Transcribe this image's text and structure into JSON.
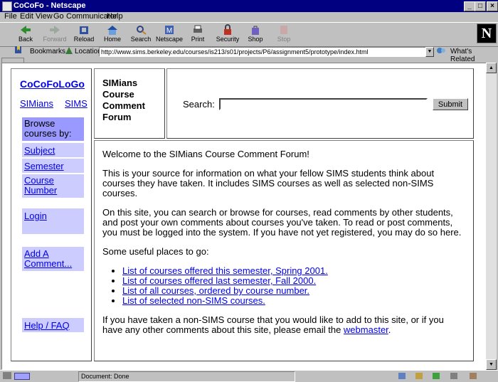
{
  "window": {
    "title": "CoCoFo - Netscape"
  },
  "menu": [
    "File",
    "Edit",
    "View",
    "Go",
    "Communicator",
    "Help"
  ],
  "toolbar": {
    "buttons": [
      {
        "label": "Back",
        "icon": "back-arrow-icon",
        "disabled": false
      },
      {
        "label": "Forward",
        "icon": "forward-arrow-icon",
        "disabled": true
      },
      {
        "label": "Reload",
        "icon": "reload-icon",
        "disabled": false
      },
      {
        "label": "Home",
        "icon": "home-icon",
        "disabled": false
      },
      {
        "label": "Search",
        "icon": "search-icon",
        "disabled": false
      },
      {
        "label": "Netscape",
        "icon": "netscape-icon",
        "disabled": false
      },
      {
        "label": "Print",
        "icon": "print-icon",
        "disabled": false
      },
      {
        "label": "Security",
        "icon": "lock-icon",
        "disabled": false
      },
      {
        "label": "Shop",
        "icon": "shop-icon",
        "disabled": false
      },
      {
        "label": "Stop",
        "icon": "stop-icon",
        "disabled": true
      }
    ],
    "logo": "N"
  },
  "location": {
    "bookmarks_label": "Bookmarks",
    "location_label": "Location:",
    "url": "http://www.sims.berkeley.edu/courses/is213/s01/projects/P6/assignment5/prototype/index.html",
    "whats_related": "What's Related"
  },
  "status": {
    "text": "Document: Done"
  },
  "sidebar": {
    "logo": "CoCoFoLoGo",
    "simians": "SIMians",
    "sims": "SIMS",
    "browse_header": "Browse courses by:",
    "browse_items": [
      "Subject",
      "Semester",
      "Course Number"
    ],
    "login": "Login",
    "add_comment": "Add A Comment...",
    "help": "Help / FAQ"
  },
  "header": {
    "forum_title": "SIMians Course Comment Forum",
    "search_label": "Search:",
    "search_value": "",
    "submit": "Submit"
  },
  "content": {
    "welcome": "Welcome to the SIMians Course Comment Forum!",
    "para1": "This is your source for information on what your fellow SIMS students think about courses they have taken. It includes SIMS courses as well as selected non-SIMS courses.",
    "para2": "On this site, you can search or browse for courses, read comments by other students, and post your own comments about courses you've taken. To read or post comments, you must be logged into the system. If you have not yet registered, you may do so here.",
    "places_intro": "Some useful places to go:",
    "places": [
      "List of courses offered this semester, Spring 2001.",
      "List of courses offered last semester, Fall 2000.",
      "List of all courses, ordered by course number.",
      "List of selected non-SIMS courses."
    ],
    "closing_text": "If you have taken a non-SIMS course that you would like to add to this site, or if you have any other comments about this site, please email the",
    "webmaster": "webmaster",
    "closing_end": "."
  }
}
